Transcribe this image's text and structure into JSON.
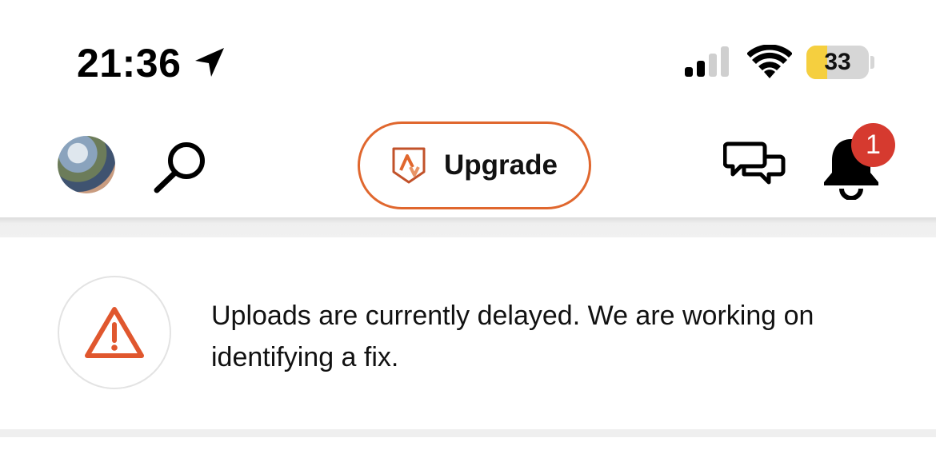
{
  "status_bar": {
    "time": "21:36",
    "battery_level": "33",
    "battery_fraction": 0.33,
    "battery_color": "#f5cf3f",
    "signal_bars_active": 2,
    "signal_bars_total": 4
  },
  "top_nav": {
    "upgrade_label": "Upgrade",
    "notification_count": "1",
    "accent_color": "#e0672e",
    "badge_color": "#d63a2f"
  },
  "banner": {
    "message": "Uploads are currently delayed. We are working on identifying a fix.",
    "icon": "warning-icon",
    "icon_color": "#e0572e"
  }
}
